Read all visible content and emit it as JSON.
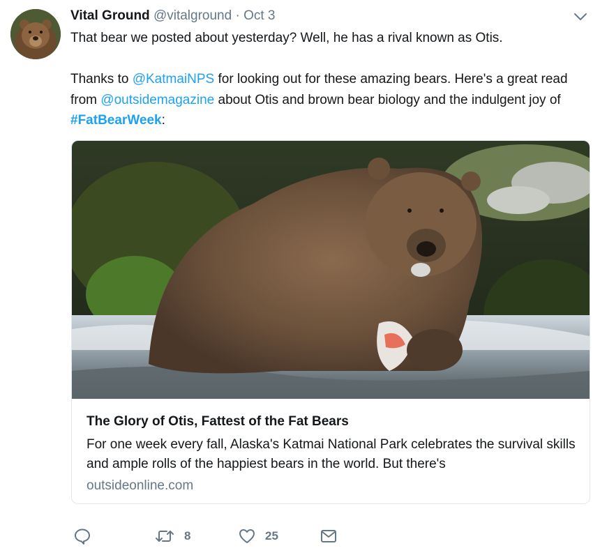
{
  "tweet": {
    "author": {
      "name": "Vital Ground",
      "handle": "@vitalground"
    },
    "separator": "·",
    "date": "Oct 3",
    "text": {
      "line1": "That bear we posted about yesterday? Well, he has a rival known as Otis.",
      "p2_before": "Thanks to ",
      "mention1": "@KatmaiNPS",
      "p2_mid": " for looking out for these amazing bears. Here's a great read from ",
      "mention2": "@outsidemagazine",
      "p2_after": " about Otis and brown bear biology and the indulgent joy of ",
      "hashtag": "#FatBearWeek",
      "p2_end": ":"
    }
  },
  "card": {
    "title": "The Glory of Otis, Fattest of the Fat Bears",
    "description": "For one week every fall, Alaska's Katmai National Park celebrates the survival skills and ample rolls of the happiest bears in the world. But there's",
    "domain": "outsideonline.com"
  },
  "actions": {
    "reply_icon": "reply-icon",
    "retweet_icon": "retweet-icon",
    "retweet_count": "8",
    "like_icon": "heart-icon",
    "like_count": "25",
    "dm_icon": "envelope-icon"
  },
  "colors": {
    "link": "#1da1f2",
    "secondary_text": "#657786",
    "primary_text": "#14171a",
    "card_border": "#e1e8ed"
  }
}
